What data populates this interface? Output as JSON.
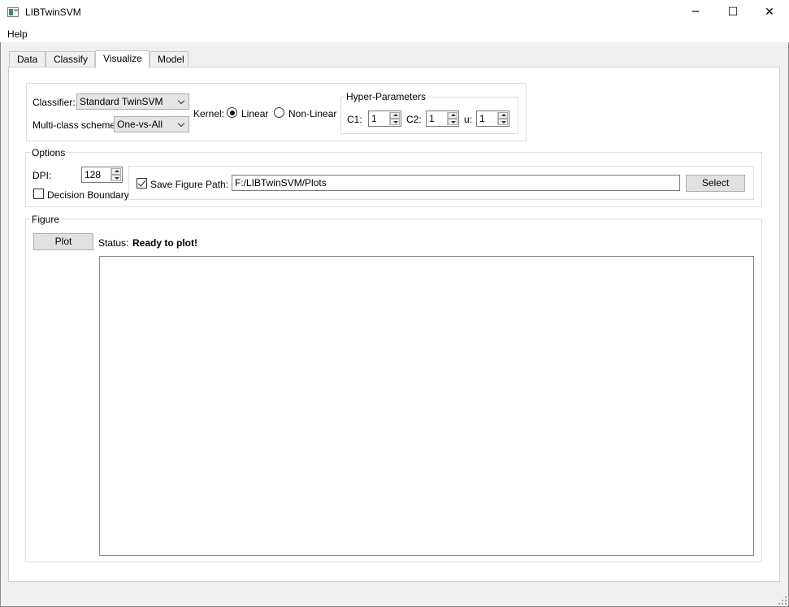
{
  "window": {
    "title": "LIBTwinSVM",
    "minimize_glyph": "─",
    "maximize_glyph": "☐",
    "close_glyph": "✕"
  },
  "menu": {
    "help": "Help"
  },
  "tabs": [
    {
      "label": "Data"
    },
    {
      "label": "Classify"
    },
    {
      "label": "Visualize"
    },
    {
      "label": "Model"
    }
  ],
  "active_tab": "Visualize",
  "classifier_section": {
    "classifier_label": "Classifier:",
    "classifier_value": "Standard TwinSVM",
    "multiclass_label": "Multi-class scheme:",
    "multiclass_value": "One-vs-All",
    "kernel_label": "Kernel:",
    "kernel_options": [
      {
        "label": "Linear",
        "checked": true
      },
      {
        "label": "Non-Linear",
        "checked": false
      }
    ]
  },
  "hyper_parameters": {
    "title": "Hyper-Parameters",
    "c1_label": "C1:",
    "c1_value": "1",
    "c2_label": "C2:",
    "c2_value": "1",
    "u_label": "u:",
    "u_value": "1"
  },
  "options": {
    "title": "Options",
    "dpi_label": "DPI:",
    "dpi_value": "128",
    "decision_boundary_label": "Decision Boundary",
    "decision_boundary_checked": false,
    "save_figure_label": "Save Figure",
    "save_figure_checked": true,
    "path_label": "Path:",
    "path_value": "F:/LIBTwinSVM/Plots",
    "select_button": "Select"
  },
  "figure": {
    "title": "Figure",
    "plot_button": "Plot",
    "status_label": "Status:",
    "status_value": "Ready to plot!"
  }
}
